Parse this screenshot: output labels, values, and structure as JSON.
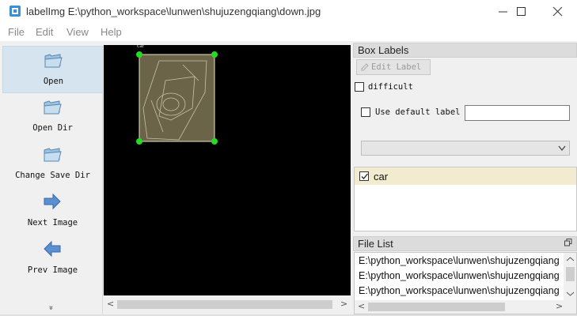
{
  "window": {
    "title": "labelImg E:\\python_workspace\\lunwen\\shujuzengqiang\\down.jpg"
  },
  "menu": [
    "File",
    "Edit",
    "View",
    "Help"
  ],
  "toolbar": {
    "items": [
      {
        "label": "Open",
        "icon": "folder-open-icon",
        "active": true
      },
      {
        "label": "Open Dir",
        "icon": "folder-open-icon",
        "active": false
      },
      {
        "label": "Change Save Dir",
        "icon": "folder-open-icon",
        "active": false
      },
      {
        "label": "Next Image",
        "icon": "arrow-right-icon",
        "active": false
      },
      {
        "label": "Prev Image",
        "icon": "arrow-left-icon",
        "active": false
      }
    ],
    "more": "»"
  },
  "canvas": {
    "bbox_label": "car",
    "colors": {
      "box_fill": "#6b6448",
      "handle": "#22dd22",
      "background": "#000000"
    }
  },
  "box_labels": {
    "title": "Box Labels",
    "edit_label": "Edit Label",
    "difficult": "difficult",
    "use_default_label": "Use default label",
    "default_label_value": "",
    "items": [
      {
        "label": "car",
        "checked": true
      }
    ]
  },
  "file_list": {
    "title": "File List",
    "files": [
      "E:\\python_workspace\\lunwen\\shujuzengqiang",
      "E:\\python_workspace\\lunwen\\shujuzengqiang",
      "E:\\python_workspace\\lunwen\\shujuzengqiang"
    ]
  }
}
